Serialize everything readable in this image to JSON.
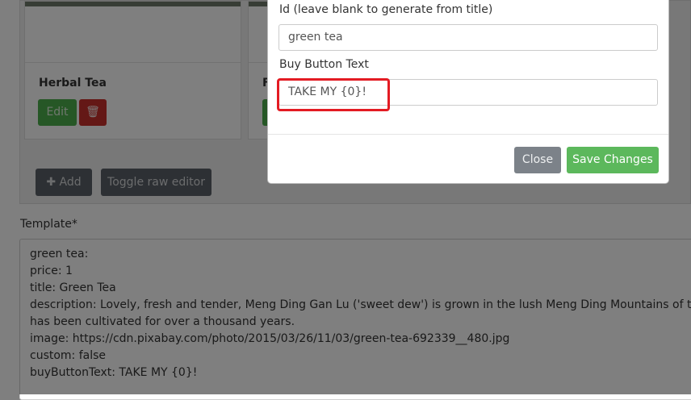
{
  "cards": [
    {
      "name": "Herbal Tea",
      "edit_label": "Edit"
    },
    {
      "name": "F",
      "edit_label": ""
    }
  ],
  "toolbar": {
    "add_label": "Add",
    "toggle_label": "Toggle raw editor"
  },
  "template": {
    "label": "Template*",
    "lines": [
      "green tea:",
      "  price: 1",
      "  title: Green Tea",
      "  description: Lovely, fresh and tender, Meng Ding Gan Lu ('sweet dew') is grown in the lush Meng Ding Mountains of the southwest Sichuan where it",
      "has been cultivated for over a thousand years.",
      "  image: https://cdn.pixabay.com/photo/2015/03/26/11/03/green-tea-692339__480.jpg",
      "  custom: false",
      "  buyButtonText: TAKE MY {0}!"
    ]
  },
  "modal": {
    "id_label": "Id (leave blank to generate from title)",
    "id_value": "green tea",
    "buy_label": "Buy Button Text",
    "buy_value": "TAKE MY {0}!",
    "close_label": "Close",
    "save_label": "Save Changes"
  },
  "icons": {
    "trash": "trash-icon",
    "plus": "plus-icon"
  },
  "colors": {
    "success": "#5cb85c",
    "danger": "#c9302c",
    "highlight": "#e31b23",
    "secondary": "#7c8289"
  }
}
